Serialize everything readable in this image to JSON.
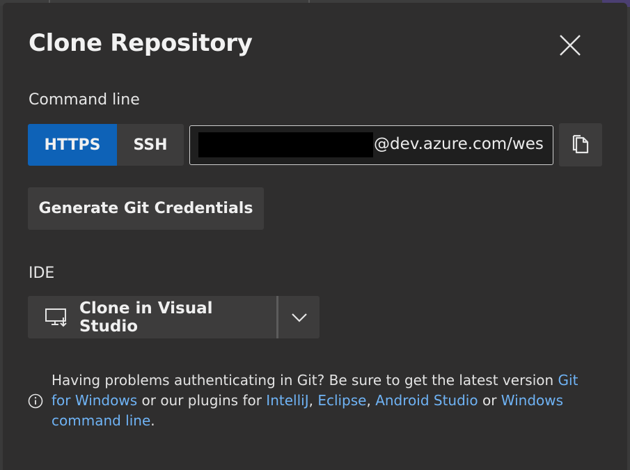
{
  "dialog": {
    "title": "Clone Repository",
    "close_icon": "close-icon"
  },
  "command_line": {
    "label": "Command line",
    "protocols": [
      {
        "label": "HTTPS",
        "selected": true
      },
      {
        "label": "SSH",
        "selected": false
      }
    ],
    "url_visible": "@dev.azure.com/wes",
    "url_redacted": true,
    "copy_icon": "copy-icon"
  },
  "credentials": {
    "button_label": "Generate Git Credentials"
  },
  "ide": {
    "label": "IDE",
    "clone_label": "Clone in Visual Studio",
    "clone_icon": "monitor-download-icon",
    "dropdown_icon": "chevron-down-icon"
  },
  "info": {
    "icon": "info-icon",
    "text_before": "Having problems authenticating in Git? Be sure to get the latest version ",
    "link_git_windows": "Git for Windows",
    "text_mid1": " or our plugins for ",
    "link_intellij": "IntelliJ",
    "sep1": ", ",
    "link_eclipse": "Eclipse",
    "sep2": ", ",
    "link_android": "Android Studio",
    "text_mid2": " or ",
    "link_cmd": "Windows command line",
    "text_end": "."
  },
  "colors": {
    "primary_button": "#0e62b7",
    "link": "#6fb3f5",
    "dialog_bg": "#2f2e2e"
  }
}
